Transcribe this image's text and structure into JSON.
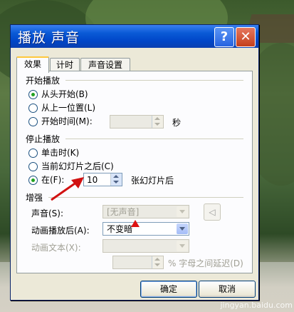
{
  "window": {
    "title": "播放 声音",
    "help_glyph": "?",
    "close_glyph": "✕"
  },
  "tabs": [
    {
      "label": "效果",
      "active": true
    },
    {
      "label": "计时",
      "active": false
    },
    {
      "label": "声音设置",
      "active": false
    }
  ],
  "start": {
    "group_label": "开始播放",
    "opt1": "从头开始(B)",
    "opt2": "从上一位置(L)",
    "opt3": "开始时间(M):",
    "time_value": "",
    "time_unit": "秒",
    "selected": 0
  },
  "stop": {
    "group_label": "停止播放",
    "opt1": "单击时(K)",
    "opt2": "当前幻灯片之后(C)",
    "opt3": "在(F):",
    "slides_value": "10",
    "slides_suffix": "张幻灯片后",
    "selected": 2
  },
  "enhance": {
    "group_label": "增强",
    "sound_label": "声音(S):",
    "sound_value": "[无声音]",
    "after_anim_label": "动画播放后(A):",
    "after_anim_value": "不变暗",
    "anim_text_label": "动画文本(X):",
    "anim_text_value": "",
    "delay_value": "",
    "delay_suffix": "% 字母之间延迟(D)"
  },
  "buttons": {
    "ok": "确定",
    "cancel": "取消"
  },
  "watermark": "jingyan.baidu.com",
  "colors": {
    "titlebar": "#0a5ad6",
    "annotation": "#d11111"
  }
}
